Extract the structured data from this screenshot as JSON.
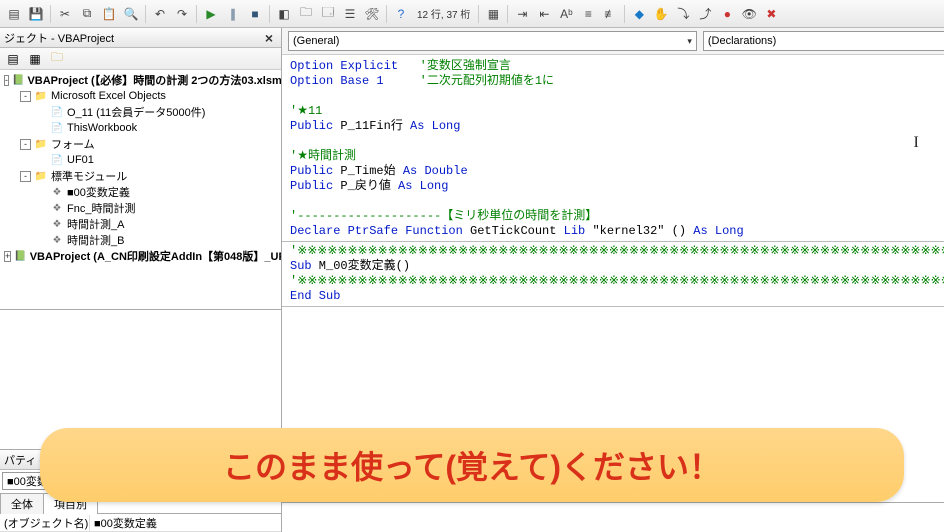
{
  "toolbar": {
    "pos_text": "12 行, 37 桁"
  },
  "project_panel": {
    "title": "ジェクト - VBAProject",
    "nodes": [
      {
        "depth": 0,
        "toggle": "-",
        "icon": "proj",
        "label": "VBAProject (【必修】時間の計測 2つの方法03.xlsm"
      },
      {
        "depth": 1,
        "toggle": "-",
        "icon": "fold",
        "label": "Microsoft Excel Objects"
      },
      {
        "depth": 2,
        "toggle": "",
        "icon": "doc",
        "label": "O_11 (11会員データ5000件)"
      },
      {
        "depth": 2,
        "toggle": "",
        "icon": "doc",
        "label": "ThisWorkbook"
      },
      {
        "depth": 1,
        "toggle": "-",
        "icon": "fold",
        "label": "フォーム"
      },
      {
        "depth": 2,
        "toggle": "",
        "icon": "doc",
        "label": "UF01"
      },
      {
        "depth": 1,
        "toggle": "-",
        "icon": "fold",
        "label": "標準モジュール"
      },
      {
        "depth": 2,
        "toggle": "",
        "icon": "mod",
        "label": "■00変数定義"
      },
      {
        "depth": 2,
        "toggle": "",
        "icon": "mod",
        "label": "Fnc_時間計測"
      },
      {
        "depth": 2,
        "toggle": "",
        "icon": "mod",
        "label": "時間計測_A"
      },
      {
        "depth": 2,
        "toggle": "",
        "icon": "mod",
        "label": "時間計測_B"
      },
      {
        "depth": 0,
        "toggle": "+",
        "icon": "proj",
        "label": "VBAProject (A_CN印刷設定AddIn【第048版】_UF"
      }
    ]
  },
  "props_panel": {
    "title": "パティ - ■00変数定義",
    "dropdown": "■00変数定義 Module",
    "tabs": {
      "all": "全体",
      "cat": "項目別"
    },
    "rows": [
      {
        "k": "(オブジェクト名)",
        "v": "■00変数定義"
      }
    ]
  },
  "code_dd": {
    "left": "(General)",
    "right": "(Declarations)"
  },
  "code": {
    "l01a": "Option Explicit",
    "l01b": "   '変数区強制宣言",
    "l02a": "Option Base 1",
    "l02b": "     '二次元配列初期値を1に",
    "l03": "'★11",
    "l04a": "Public",
    "l04b": " P_11Fin行 ",
    "l04c": "As Long",
    "l05": "'★時間計測",
    "l06a": "Public",
    "l06b": " P_Time始 ",
    "l06c": "As Double",
    "l07a": "Public",
    "l07b": " P_戻り値 ",
    "l07c": "As Long",
    "l08": "'--------------------【ミリ秒単位の時間を計測】",
    "l09a": "Declare PtrSafe Function",
    "l09b": " GetTickCount ",
    "l09c": "Lib",
    "l09d": " \"kernel32\" () ",
    "l09e": "As Long",
    "l10": "'※※※※※※※※※※※※※※※※※※※※※※※※※※※※※※※※※※※※※※※※※※※※※※※※※※※※※※※※※※※※※※※※※※※",
    "l11a": "Sub",
    "l11b": " M_00変数定義()",
    "l12": "'※※※※※※※※※※※※※※※※※※※※※※※※※※※※※※※※※※※※※※※※※※※※※※※※※※※※※※※※※※※※※※※※※※※",
    "l13": "End Sub"
  },
  "caption": "このまま使って(覚えて)ください！"
}
